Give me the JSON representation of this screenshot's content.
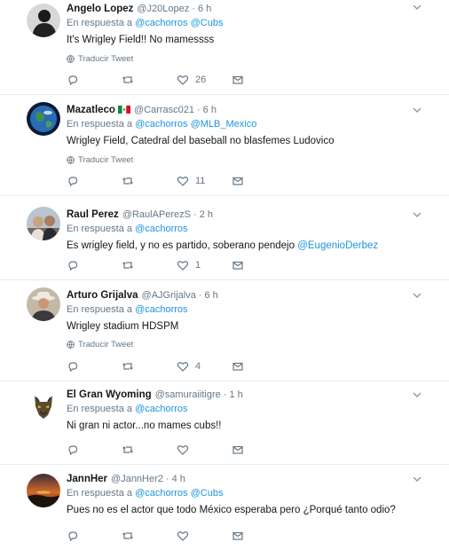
{
  "tweets": [
    {
      "name": "Angelo Lopez",
      "handle": "@J20Lopez",
      "time": "6 h",
      "reply_prefix": "En respuesta a",
      "reply_to": [
        "@cachorros",
        "@Cubs"
      ],
      "text": "It's Wrigley Field!! No mamessss",
      "translate": "Traducir Tweet",
      "likes": "26"
    },
    {
      "name": "Mazatleco",
      "handle": "@Carrasc021",
      "time": "6 h",
      "reply_prefix": "En respuesta a",
      "reply_to": [
        "@cachorros",
        "@MLB_Mexico"
      ],
      "text": "Wrigley Field, Catedral del baseball no blasfemes Ludovico",
      "translate": "Traducir Tweet",
      "likes": "11"
    },
    {
      "name": "Raul Perez",
      "handle": "@RaulAPerezS",
      "time": "2 h",
      "reply_prefix": "En respuesta a",
      "reply_to": [
        "@cachorros"
      ],
      "text": "Es wrigley field, y no es partido, soberano pendejo",
      "text_mention": "@EugenioDerbez",
      "likes": "1"
    },
    {
      "name": "Arturo Grijalva",
      "handle": "@AJGrijalva",
      "time": "6 h",
      "reply_prefix": "En respuesta a",
      "reply_to": [
        "@cachorros"
      ],
      "text": "Wrigley stadium HDSPM",
      "translate": "Traducir Tweet",
      "likes": "4"
    },
    {
      "name": "El Gran Wyoming",
      "handle": "@samuraiitigre",
      "time": "1 h",
      "reply_prefix": "En respuesta a",
      "reply_to": [
        "@cachorros"
      ],
      "text": "Ni gran ni actor...no mames cubs!!",
      "likes": ""
    },
    {
      "name": "JannHer",
      "handle": "@JannHer2",
      "time": "4 h",
      "reply_prefix": "En respuesta a",
      "reply_to": [
        "@cachorros",
        "@Cubs"
      ],
      "text": "Pues no es el actor que todo México esperaba pero ¿Porqué tanto odio?",
      "likes": ""
    }
  ],
  "dot": "·",
  "colors": {
    "link": "#1b95e0",
    "secondary": "#657786",
    "divider": "#e6ecf0"
  },
  "icons": [
    "reply-icon",
    "retweet-icon",
    "like-icon",
    "message-icon",
    "chevron-down-icon",
    "globe-icon"
  ]
}
